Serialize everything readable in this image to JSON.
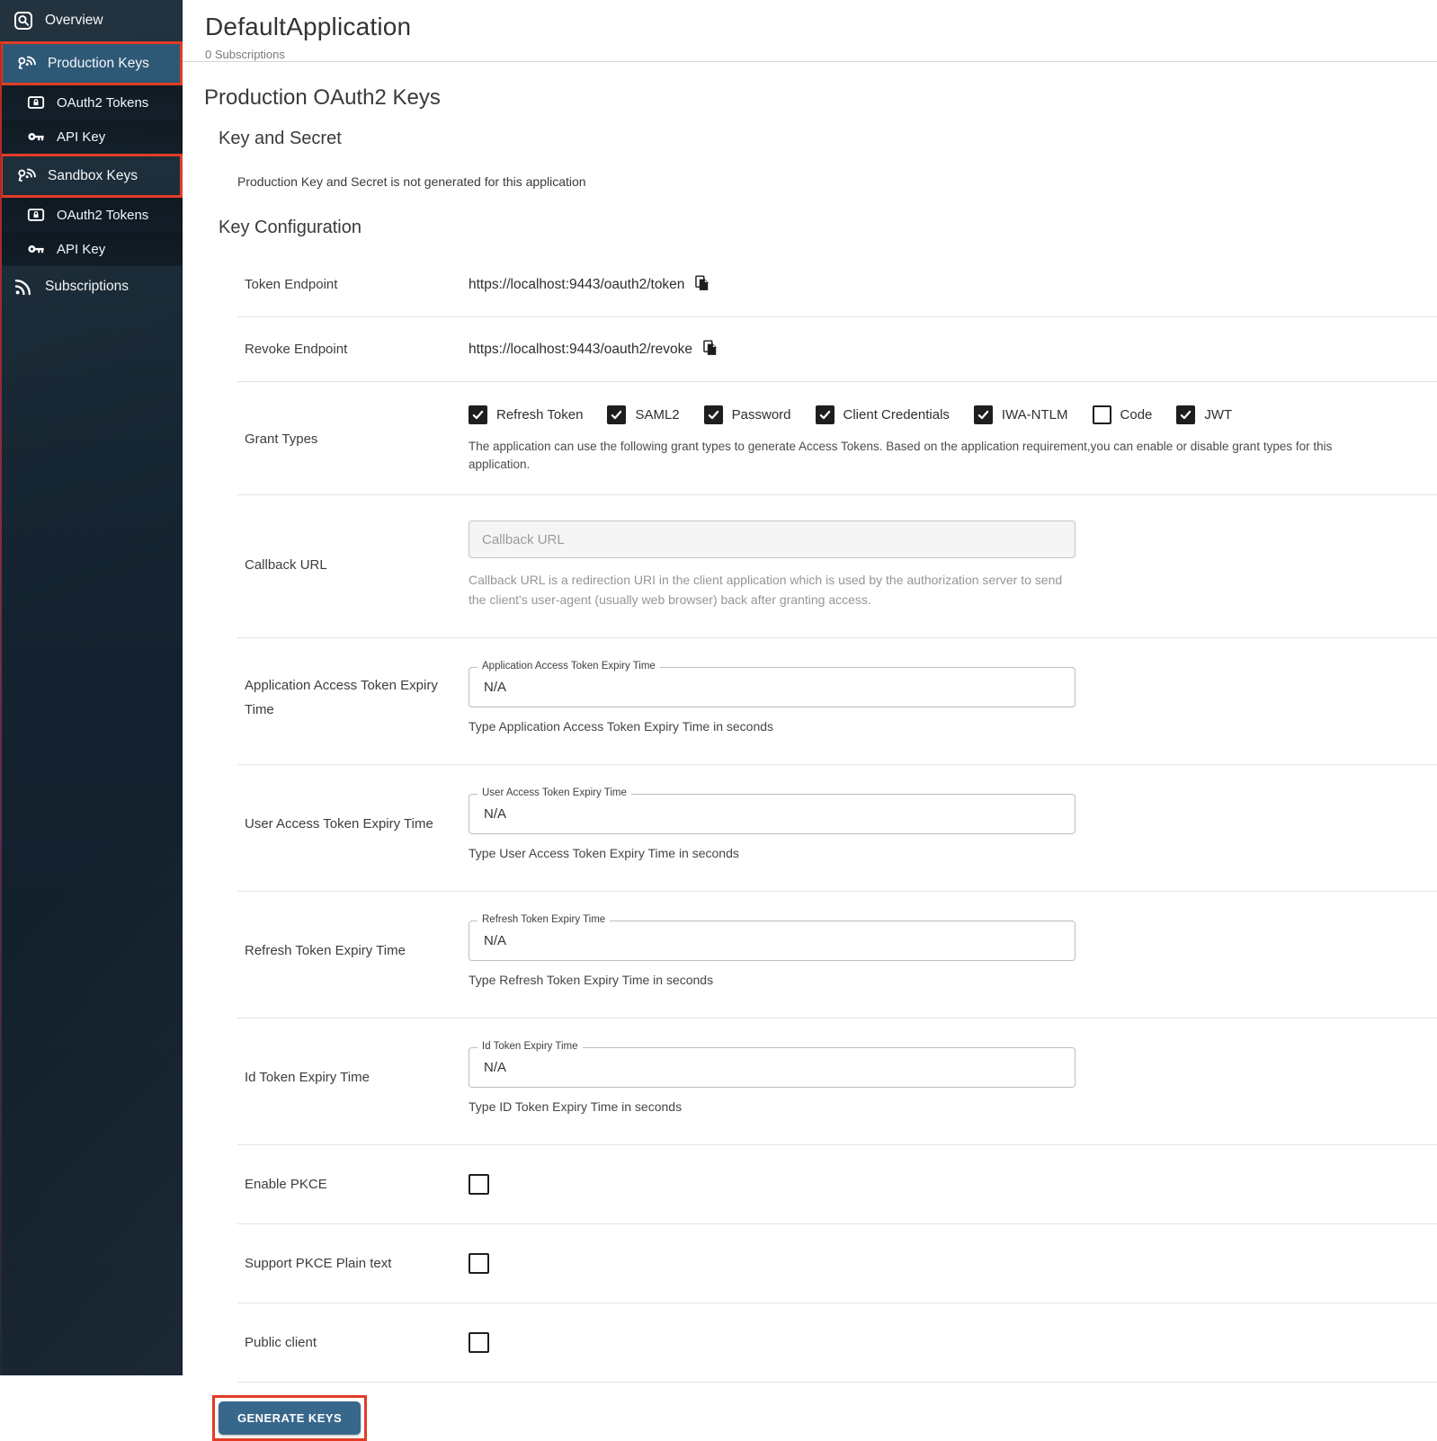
{
  "header": {
    "title": "DefaultApplication",
    "subtitle": "0 Subscriptions"
  },
  "sidebar": {
    "items": [
      {
        "label": "Overview",
        "icon": "overview-icon",
        "level": "top"
      },
      {
        "label": "Production Keys",
        "icon": "keys-signal-icon",
        "level": "top",
        "selected": true,
        "annotated": true
      },
      {
        "label": "OAuth2 Tokens",
        "icon": "token-card-icon",
        "level": "sub"
      },
      {
        "label": "API Key",
        "icon": "api-key-icon",
        "level": "sub"
      },
      {
        "label": "Sandbox Keys",
        "icon": "keys-signal-icon",
        "level": "top",
        "annotated": true
      },
      {
        "label": "OAuth2 Tokens",
        "icon": "token-card-icon",
        "level": "sub"
      },
      {
        "label": "API Key",
        "icon": "api-key-icon",
        "level": "sub"
      },
      {
        "label": "Subscriptions",
        "icon": "subscriptions-icon",
        "level": "top"
      }
    ]
  },
  "main": {
    "section_title": "Production OAuth2 Keys",
    "key_and_secret": {
      "title": "Key and Secret",
      "message": "Production Key and Secret is not generated for this application"
    },
    "key_configuration_title": "Key Configuration",
    "endpoints": [
      {
        "label": "Token Endpoint",
        "value": "https://localhost:9443/oauth2/token",
        "icon": "copy-icon"
      },
      {
        "label": "Revoke Endpoint",
        "value": "https://localhost:9443/oauth2/revoke",
        "icon": "copy-icon"
      }
    ],
    "grant_types": {
      "label": "Grant Types",
      "options": [
        {
          "label": "Refresh Token",
          "checked": true
        },
        {
          "label": "SAML2",
          "checked": true
        },
        {
          "label": "Password",
          "checked": true
        },
        {
          "label": "Client Credentials",
          "checked": true
        },
        {
          "label": "IWA-NTLM",
          "checked": true
        },
        {
          "label": "Code",
          "checked": false
        },
        {
          "label": "JWT",
          "checked": true
        }
      ],
      "helper": "The application can use the following grant types to generate Access Tokens. Based on the application requirement,you can enable or disable grant types for this application."
    },
    "callback": {
      "label": "Callback URL",
      "placeholder": "Callback URL",
      "value": "",
      "helper": "Callback URL is a redirection URI in the client application which is used by the authorization server to send the client's user-agent (usually web browser) back after granting access."
    },
    "expiry_fields": [
      {
        "row_label": "Application Access Token Expiry Time",
        "legend": "Application Access Token Expiry Time",
        "value": "N/A",
        "helper": "Type Application Access Token Expiry Time in seconds"
      },
      {
        "row_label": "User Access Token Expiry Time",
        "legend": "User Access Token Expiry Time",
        "value": "N/A",
        "helper": "Type User Access Token Expiry Time in seconds"
      },
      {
        "row_label": "Refresh Token Expiry Time",
        "legend": "Refresh Token Expiry Time",
        "value": "N/A",
        "helper": "Type Refresh Token Expiry Time in seconds"
      },
      {
        "row_label": "Id Token Expiry Time",
        "legend": "Id Token Expiry Time",
        "value": "N/A",
        "helper": "Type ID Token Expiry Time in seconds"
      }
    ],
    "pkce_rows": [
      {
        "label": "Enable PKCE",
        "checked": false
      },
      {
        "label": "Support PKCE Plain text",
        "checked": false
      },
      {
        "label": "Public client",
        "checked": false
      }
    ],
    "generate_button_label": "GENERATE KEYS"
  },
  "colors": {
    "sidebar_bg": "#13222e",
    "sidebar_selected": "#2d5876",
    "annotation_red": "#e23c26",
    "button_blue": "#38678c",
    "checkbox_dark": "#1e1e1e"
  }
}
